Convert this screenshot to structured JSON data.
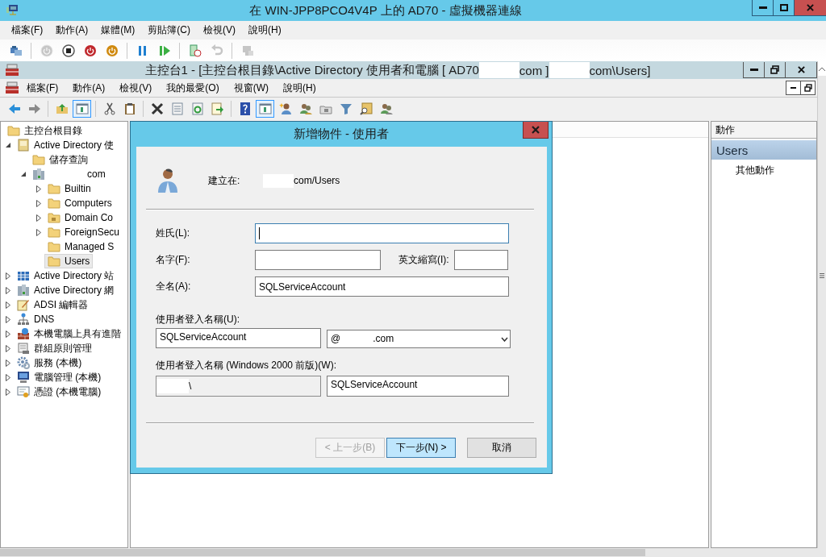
{
  "vm_window": {
    "title": "在 WIN-JPP8PCO4V4P 上的 AD70 - 虛擬機器連線",
    "menu": [
      "檔案(F)",
      "動作(A)",
      "媒體(M)",
      "剪貼簿(C)",
      "檢視(V)",
      "說明(H)"
    ],
    "toolbar": [
      {
        "kind": "ctrl-alt-del",
        "disabled": false
      },
      {
        "kind": "separator"
      },
      {
        "kind": "start",
        "disabled": true
      },
      {
        "kind": "turn-off",
        "disabled": false
      },
      {
        "kind": "shutdown",
        "disabled": false
      },
      {
        "kind": "save",
        "disabled": false
      },
      {
        "kind": "separator"
      },
      {
        "kind": "pause",
        "disabled": false
      },
      {
        "kind": "resume",
        "disabled": false
      },
      {
        "kind": "separator"
      },
      {
        "kind": "checkpoint",
        "disabled": false
      },
      {
        "kind": "revert",
        "disabled": true
      },
      {
        "kind": "separator"
      },
      {
        "kind": "enhanced",
        "disabled": true
      }
    ]
  },
  "console": {
    "title": [
      {
        "kind": "text",
        "text": "主控台1 - [主控台根目錄\\Active Directory 使用者和電腦 [ AD70"
      },
      {
        "kind": "redacted"
      },
      {
        "kind": "text",
        "text": "com ]"
      },
      {
        "kind": "redacted"
      },
      {
        "kind": "text",
        "text": "com\\Users]"
      }
    ],
    "menu": [
      "檔案(F)",
      "動作(A)",
      "檢視(V)",
      "我的最愛(O)",
      "視窗(W)",
      "說明(H)"
    ],
    "toolbar": [
      {
        "kind": "back",
        "pressed": false
      },
      {
        "kind": "forward",
        "pressed": false
      },
      {
        "kind": "separator"
      },
      {
        "kind": "up",
        "pressed": false
      },
      {
        "kind": "console-tree",
        "pressed": true
      },
      {
        "kind": "separator"
      },
      {
        "kind": "cut",
        "pressed": false
      },
      {
        "kind": "copy",
        "pressed": false
      },
      {
        "kind": "separator"
      },
      {
        "kind": "delete",
        "pressed": false
      },
      {
        "kind": "properties",
        "pressed": false
      },
      {
        "kind": "refresh",
        "pressed": false
      },
      {
        "kind": "export",
        "pressed": false
      },
      {
        "kind": "separator"
      },
      {
        "kind": "help",
        "pressed": false
      },
      {
        "kind": "action-pane",
        "pressed": true
      },
      {
        "kind": "new-user",
        "pressed": false
      },
      {
        "kind": "new-group",
        "pressed": false
      },
      {
        "kind": "new-ou",
        "pressed": false
      },
      {
        "kind": "filter",
        "pressed": false
      },
      {
        "kind": "find",
        "pressed": false
      },
      {
        "kind": "add-to-group",
        "pressed": false
      }
    ],
    "tree": [
      {
        "label": "主控台根目錄",
        "kind": "folder",
        "expandable": false,
        "selected": false,
        "children": [
          {
            "label": "Active Directory 使",
            "kind": "book",
            "expandable": true,
            "expanded": true,
            "selected": false,
            "children": [
              {
                "label": "儲存查詢",
                "kind": "folder",
                "expandable": false,
                "selected": false
              },
              {
                "label": "com",
                "kind": "domain",
                "expandable": true,
                "expanded": true,
                "selected": false,
                "redacted_prefix": true,
                "children": [
                  {
                    "label": "Builtin",
                    "kind": "folder",
                    "expandable": true,
                    "expanded": false,
                    "selected": false
                  },
                  {
                    "label": "Computers",
                    "kind": "folder",
                    "expandable": true,
                    "expanded": false,
                    "selected": false
                  },
                  {
                    "label": "Domain Co",
                    "kind": "special-folder",
                    "expandable": true,
                    "expanded": false,
                    "selected": false
                  },
                  {
                    "label": "ForeignSecu",
                    "kind": "folder",
                    "expandable": true,
                    "expanded": false,
                    "selected": false
                  },
                  {
                    "label": "Managed S",
                    "kind": "folder",
                    "expandable": false,
                    "selected": false
                  },
                  {
                    "label": "Users",
                    "kind": "folder",
                    "expandable": false,
                    "selected": true
                  }
                ]
              }
            ]
          },
          {
            "label": "Active Directory 站",
            "kind": "sites",
            "expandable": true,
            "expanded": false,
            "selected": false
          },
          {
            "label": "Active Directory 網",
            "kind": "domains",
            "expandable": true,
            "expanded": false,
            "selected": false
          },
          {
            "label": "ADSI 編輯器",
            "kind": "notepad",
            "expandable": true,
            "expanded": false,
            "selected": false
          },
          {
            "label": "DNS",
            "kind": "network",
            "expandable": true,
            "expanded": false,
            "selected": false
          },
          {
            "label": "本機電腦上具有進階",
            "kind": "firewall",
            "expandable": true,
            "expanded": false,
            "selected": false
          },
          {
            "label": "群組原則管理",
            "kind": "scroll",
            "expandable": true,
            "expanded": false,
            "selected": false
          },
          {
            "label": "服務 (本機)",
            "kind": "gear",
            "expandable": true,
            "expanded": false,
            "selected": false
          },
          {
            "label": "電腦管理 (本機)",
            "kind": "monitor",
            "expandable": true,
            "expanded": false,
            "selected": false
          },
          {
            "label": "憑證 (本機電腦)",
            "kind": "certificate",
            "expandable": true,
            "expanded": false,
            "selected": false
          }
        ]
      }
    ],
    "actions": {
      "header": "動作",
      "items": [
        {
          "kind": "section",
          "label": "Users",
          "selected": true
        },
        {
          "kind": "action",
          "label": "其他動作",
          "selected": false
        }
      ]
    }
  },
  "dialog": {
    "title": "新增物件 - 使用者",
    "create_in": {
      "label": "建立在:",
      "value": [
        {
          "kind": "redacted"
        },
        {
          "kind": "text",
          "text": "com/Users"
        }
      ]
    },
    "last_name": {
      "label": "姓氏(L):",
      "focused": true
    },
    "first_name": {
      "label": "名字(F):",
      "focused": false
    },
    "initials": {
      "label": "英文縮寫(I):",
      "focused": false
    },
    "full_name": {
      "label": "全名(A):",
      "value": "SQLServiceAccount",
      "focused": false
    },
    "logon_name": {
      "label": "使用者登入名稱(U):",
      "value": "SQLServiceAccount",
      "domain": [
        {
          "kind": "text",
          "text": "@"
        },
        {
          "kind": "redacted"
        },
        {
          "kind": "text",
          "text": ".com"
        }
      ]
    },
    "logon_name_pre2000": {
      "label": "使用者登入名稱 (Windows 2000 前版)(W):",
      "domain": [
        {
          "kind": "redacted"
        },
        {
          "kind": "text",
          "text": "\\"
        }
      ],
      "value": "SQLServiceAccount"
    },
    "buttons": [
      {
        "label": "< 上一步(B)",
        "disabled": true,
        "default": false
      },
      {
        "label": "下一步(N) >",
        "disabled": false,
        "default": true
      },
      {
        "label": "取消",
        "disabled": false,
        "default": false
      }
    ]
  }
}
